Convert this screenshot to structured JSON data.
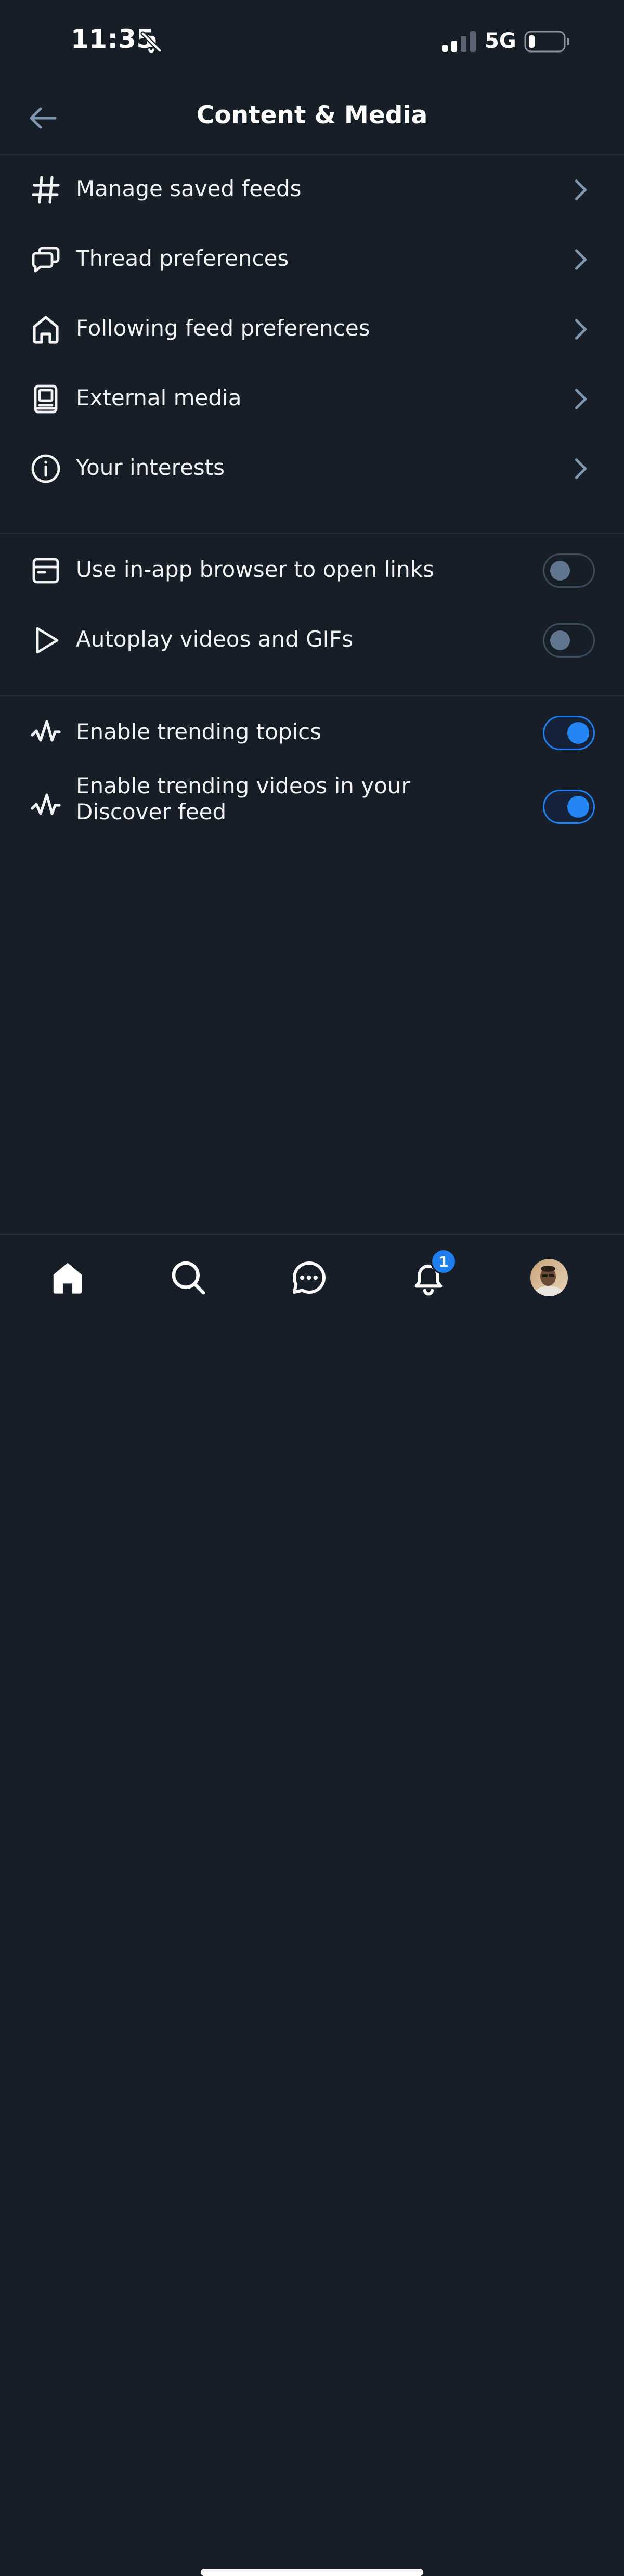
{
  "status_bar": {
    "time": "11:35",
    "network": "5G"
  },
  "header": {
    "title": "Content & Media"
  },
  "nav_items": [
    {
      "label": "Manage saved feeds",
      "icon": "hashtag-icon"
    },
    {
      "label": "Thread preferences",
      "icon": "chat-bubbles-icon"
    },
    {
      "label": "Following feed preferences",
      "icon": "home-icon"
    },
    {
      "label": "External media",
      "icon": "media-icon"
    },
    {
      "label": "Your interests",
      "icon": "info-icon"
    }
  ],
  "browser_toggles": [
    {
      "label": "Use in-app browser to open links",
      "icon": "browser-window-icon",
      "enabled": false
    },
    {
      "label": "Autoplay videos and GIFs",
      "icon": "play-icon",
      "enabled": false
    }
  ],
  "trending_toggles": [
    {
      "label": "Enable trending topics",
      "icon": "trending-icon",
      "enabled": true
    },
    {
      "label": "Enable trending videos in your Discover feed",
      "icon": "trending-icon",
      "enabled": true
    }
  ],
  "tab_bar": {
    "tabs": [
      "home",
      "search",
      "messages",
      "notifications",
      "profile"
    ],
    "notification_count": "1"
  },
  "colors": {
    "background": "#161e27",
    "accent": "#2585f5",
    "divider": "#27323e",
    "muted_icon": "#8197b0"
  }
}
